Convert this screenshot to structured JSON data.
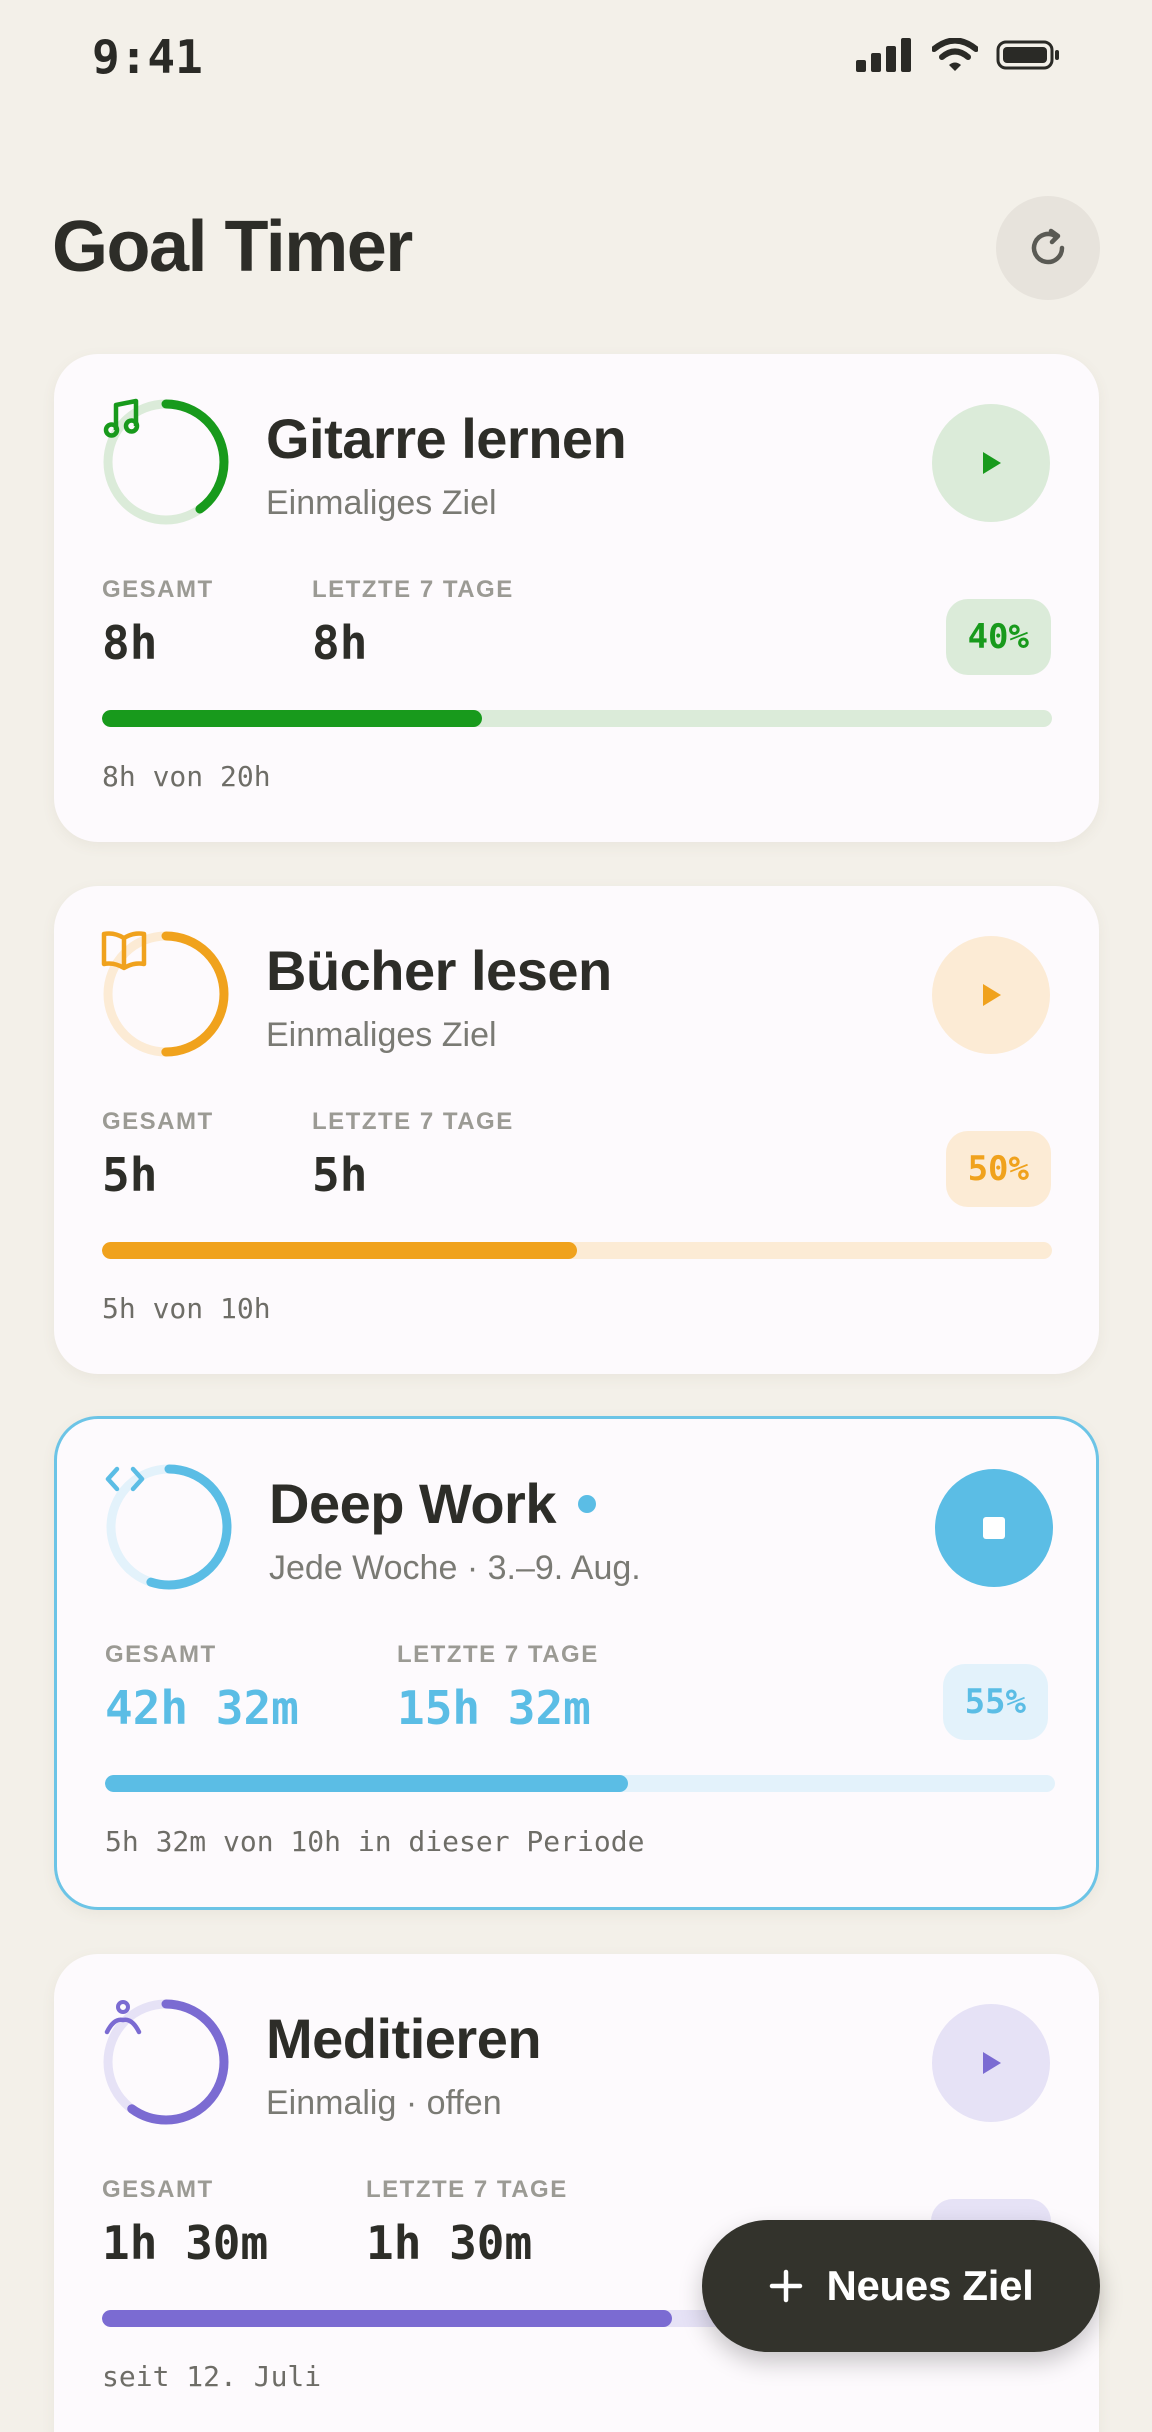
{
  "status_bar": {
    "time": "9:41"
  },
  "header": {
    "title": "Goal Timer"
  },
  "labels": {
    "total": "GESAMT",
    "last7": "LETZTE 7 TAGE"
  },
  "goals": [
    {
      "title": "Gitarre lernen",
      "subtitle": "Einmaliges Ziel",
      "icon": "music-note-icon",
      "total": "8h",
      "last7": "8h",
      "percent_label": "40%",
      "progress": 0.4,
      "caption": "8h von 20h",
      "color": "#189a1c",
      "tint": "#dbebd9",
      "active": false
    },
    {
      "title": "Bücher lesen",
      "subtitle": "Einmaliges Ziel",
      "icon": "book-icon",
      "total": "5h",
      "last7": "5h",
      "percent_label": "50%",
      "progress": 0.5,
      "caption": "5h von 10h",
      "color": "#f0a21d",
      "tint": "#fcebd5",
      "active": false
    },
    {
      "title": "Deep Work",
      "subtitle": "Jede Woche · 3.–9. Aug.",
      "icon": "code-icon",
      "total": "42h 32m",
      "last7": "15h 32m",
      "percent_label": "55%",
      "progress": 0.55,
      "caption": "5h 32m von 10h in dieser Periode",
      "color": "#5bbde5",
      "tint": "#e3f2fb",
      "active": true
    },
    {
      "title": "Meditieren",
      "subtitle": "Einmalig · offen",
      "icon": "meditation-icon",
      "total": "1h 30m",
      "last7": "1h 30m",
      "progress": 0.6,
      "caption": "seit 12. Juli",
      "color": "#7b6bd2",
      "tint": "#e6e2f6",
      "active": false
    }
  ],
  "fab": {
    "label": "Neues Ziel",
    "icon": "plus-icon"
  }
}
